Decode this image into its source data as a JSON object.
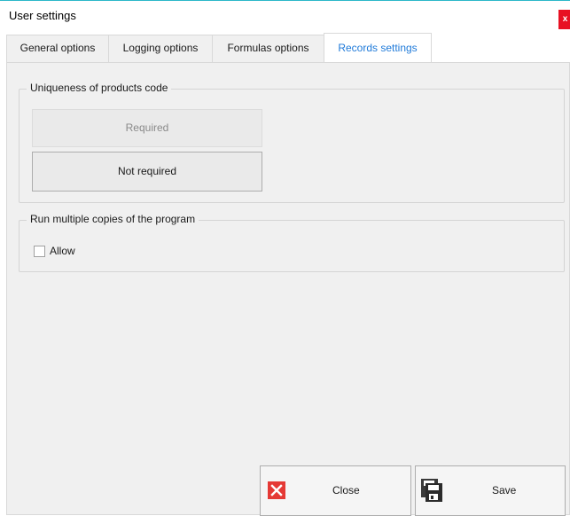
{
  "window": {
    "title": "User settings",
    "close_glyph": "x"
  },
  "tabs": [
    {
      "label": "General options",
      "active": false
    },
    {
      "label": "Logging options",
      "active": false
    },
    {
      "label": "Formulas options",
      "active": false
    },
    {
      "label": "Records settings",
      "active": true
    }
  ],
  "uniqueness_group": {
    "title": "Uniqueness of products code",
    "options": [
      {
        "label": "Required",
        "state": "disabled"
      },
      {
        "label": "Not required",
        "state": "normal"
      }
    ]
  },
  "copies_group": {
    "title": "Run multiple copies of the program",
    "allow": {
      "label": "Allow",
      "checked": false
    }
  },
  "footer": {
    "close_label": "Close",
    "save_label": "Save"
  },
  "icons": {
    "close_button_icon": "close-red-x-icon",
    "save_button_icon": "floppy-disk-icon",
    "window_close": "window-close-icon"
  },
  "colors": {
    "accent_line": "#2bb7c9",
    "active_tab_text": "#1f7ad9",
    "close_red": "#e53935",
    "panel_bg": "#f0f0f0"
  }
}
